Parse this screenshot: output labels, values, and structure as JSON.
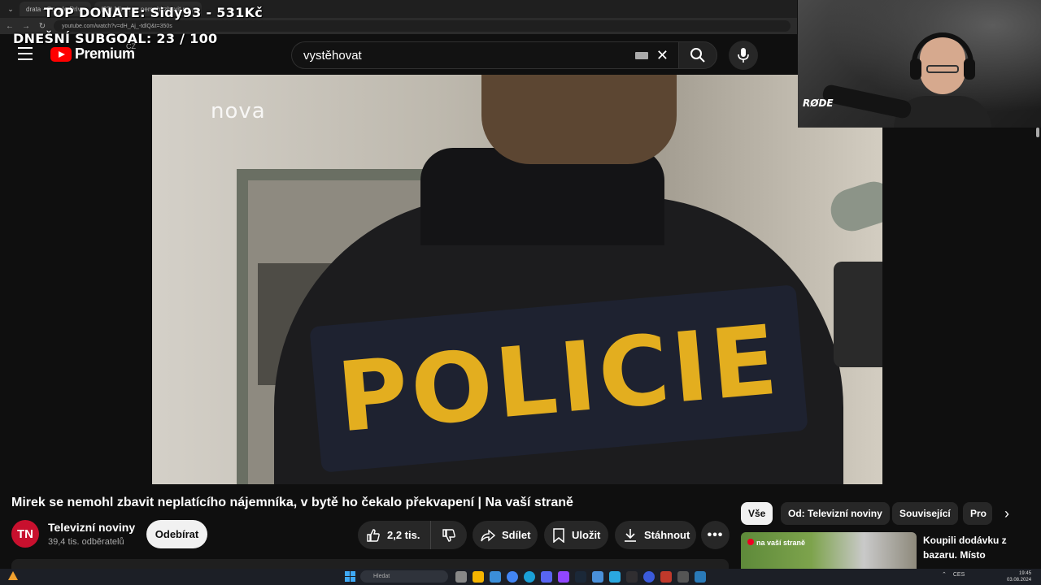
{
  "overlay": {
    "top_donate": "TOP DONATE: Sidy93 - 531Kč",
    "subgoal": "DNEŠNÍ SUBGOAL: 23 / 100"
  },
  "browser": {
    "tabs": [
      {
        "label": "drata - Google Drive"
      },
      {
        "label": "(22) Mirek se nemohl zbavit ne..."
      }
    ],
    "url": "youtube.com/watch?v=dH_Aj_-tdlQ&t=350s"
  },
  "header": {
    "logo_text": "Premium",
    "country_code": "CZ",
    "search_value": "vystěhovat"
  },
  "webcam": {
    "mic_brand": "RØDE"
  },
  "video": {
    "watermark": "nova",
    "patch_text": "POLICIE"
  },
  "meta": {
    "title": "Mirek se nemohl zbavit neplatícího nájemníka, v bytě ho čekalo překvapení | Na vaší straně",
    "channel_initials": "TN",
    "channel_name": "Televizní noviny",
    "subscribers": "39,4 tis. odběratelů",
    "subscribe_label": "Odebírat",
    "like_count": "2,2 tis.",
    "share_label": "Sdílet",
    "save_label": "Uložit",
    "download_label": "Stáhnout",
    "more_label": "•••"
  },
  "chips": [
    {
      "label": "Vše"
    },
    {
      "label": "Od: Televizní noviny"
    },
    {
      "label": "Související"
    },
    {
      "label": "Pro"
    }
  ],
  "recommendation": {
    "thumb_tag": "na vaší straně",
    "title": "Koupili dodávku z bazaru. Místo"
  },
  "taskbar": {
    "search_placeholder": "Hledat",
    "lang": "CES",
    "time": "19:45",
    "date": "03.08.2024"
  },
  "colors": {
    "youtube_red": "#ff0000",
    "patch_yellow": "#e3ae1f",
    "avatar_red": "#c8102e"
  }
}
